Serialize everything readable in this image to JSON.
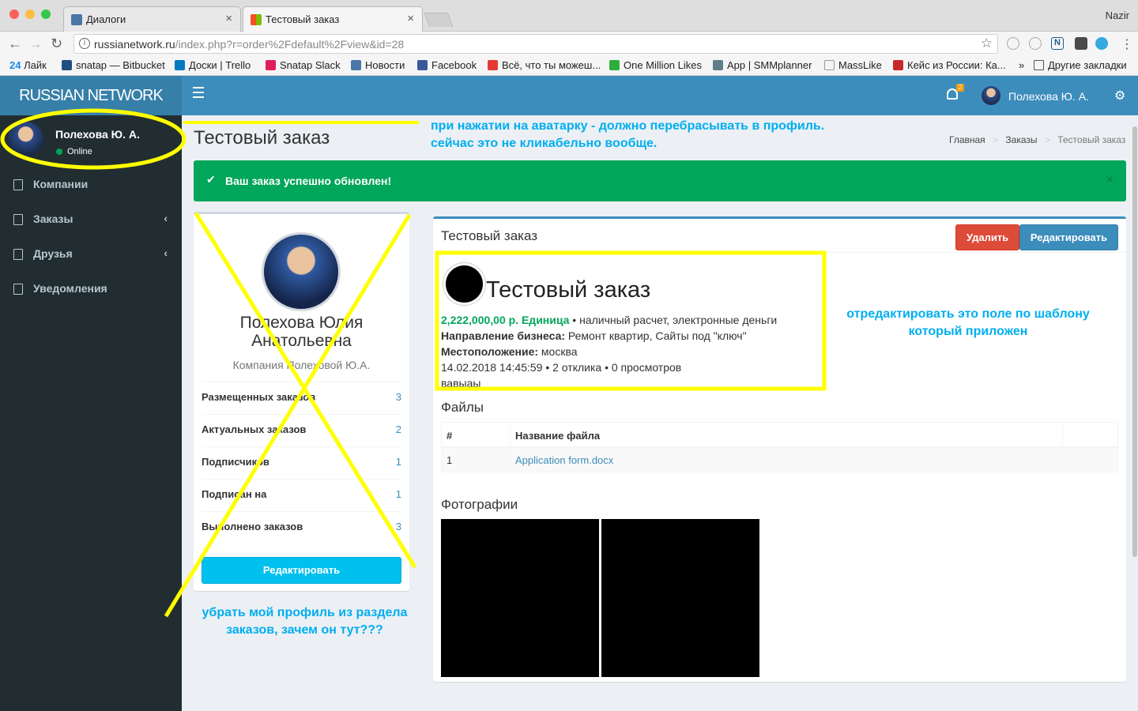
{
  "browser": {
    "tabs": [
      {
        "label": "Диалоги"
      },
      {
        "label": "Тестовый заказ"
      }
    ],
    "profile_name": "Nazir",
    "url_host": "russianetwork.ru",
    "url_path": "/index.php?r=order%2Fdefault%2Fview&id=28",
    "bookmarks": [
      {
        "label": "Лайк",
        "prefix": "24"
      },
      {
        "label": "snatap — Bitbucket"
      },
      {
        "label": "Доски | Trello"
      },
      {
        "label": "Snatap Slack"
      },
      {
        "label": "Новости"
      },
      {
        "label": "Facebook"
      },
      {
        "label": "Всё, что ты можеш..."
      },
      {
        "label": "One Million Likes"
      },
      {
        "label": "App | SMMplanner"
      },
      {
        "label": "MassLike"
      },
      {
        "label": "Кейс из России: Ка..."
      },
      {
        "label": "»"
      },
      {
        "label": "Другие закладки"
      }
    ]
  },
  "app": {
    "logo": "RUSSIAN NETWORK",
    "notif_count": "2",
    "user_name": "Полехова Ю. А.",
    "status": "Online",
    "sidebar": [
      {
        "label": "Компании"
      },
      {
        "label": "Заказы"
      },
      {
        "label": "Друзья"
      },
      {
        "label": "Уведомления"
      }
    ]
  },
  "page": {
    "title": "Тестовый заказ",
    "breadcrumb": [
      "Главная",
      "Заказы",
      "Тестовый заказ"
    ],
    "alert": "Ваш заказ успешно обновлен!"
  },
  "profile": {
    "full_name": "Полехова Юлия Анатольевна",
    "company": "Компания Полеховой Ю.А.",
    "stats": [
      {
        "label": "Размещенных заказов",
        "value": "3"
      },
      {
        "label": "Актуальных заказов",
        "value": "2"
      },
      {
        "label": "Подписчиков",
        "value": "1"
      },
      {
        "label": "Подписан на",
        "value": "1"
      },
      {
        "label": "Выполнено заказов",
        "value": "3"
      }
    ],
    "edit_button": "Редактировать"
  },
  "order": {
    "box_title": "Тестовый заказ",
    "delete_button": "Удалить",
    "edit_button": "Редактировать",
    "heading": "Тестовый заказ",
    "price": "2,222,000,00 р. Единица",
    "payment": " • наличный расчет, электронные деньги",
    "direction_label": "Направление бизнеса:",
    "direction_value": " Ремонт квартир, Сайты под \"ключ\"",
    "location_label": "Местоположение:",
    "location_value": " москва",
    "meta": "14.02.2018 14:45:59 • 2 отклика • 0 просмотров",
    "description": "вавыаы",
    "files_title": "Файлы",
    "files_header": [
      "#",
      "Название файла"
    ],
    "files": [
      {
        "num": "1",
        "name": "Application form.docx"
      }
    ],
    "photos_title": "Фотографии"
  },
  "annotations": {
    "avatar_note_1": "при нажатии на аватарку - должно перебрасывать в профиль.",
    "avatar_note_2": "сейчас это не кликабельно вообще.",
    "field_note_1": "отредактировать это поле по шаблону",
    "field_note_2": "который приложен",
    "profile_note_1": "убрать мой профиль из раздела",
    "profile_note_2": "заказов, зачем он тут???"
  },
  "colors": {
    "header": "#3c8dbc",
    "sidebar": "#222d32",
    "alert": "#00a65a",
    "annotation_yellow": "#ffff00",
    "annotation_text": "#00aeef",
    "delete": "#dd4b39",
    "info_button": "#00c0ef"
  }
}
